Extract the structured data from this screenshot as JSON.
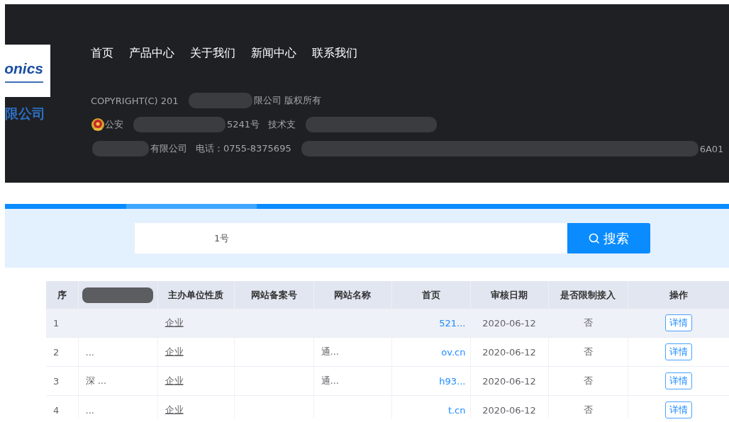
{
  "footer": {
    "logo": {
      "text": "onics",
      "subtitle": "限公司"
    },
    "nav": [
      {
        "label": "首页"
      },
      {
        "label": "产品中心"
      },
      {
        "label": "关于我们"
      },
      {
        "label": "新闻中心"
      },
      {
        "label": "联系我们"
      }
    ],
    "lines": [
      [
        {
          "kind": "text",
          "text": "COPYRIGHT(C) 201"
        },
        {
          "kind": "redacted"
        },
        {
          "kind": "text",
          "text": "限公司 版权所有"
        }
      ],
      [
        {
          "kind": "emblem"
        },
        {
          "kind": "text",
          "text": "公安"
        },
        {
          "kind": "redacted"
        },
        {
          "kind": "text",
          "text": "5241号"
        },
        {
          "kind": "text",
          "text": "技术支"
        },
        {
          "kind": "redacted"
        }
      ],
      [
        {
          "kind": "redacted"
        },
        {
          "kind": "text",
          "text": "有限公司"
        },
        {
          "kind": "text",
          "text": "电话：0755-8375695"
        },
        {
          "kind": "redacted"
        },
        {
          "kind": "text",
          "text": "6A01"
        }
      ]
    ]
  },
  "search": {
    "value": "1号",
    "button": "搜索"
  },
  "table": {
    "columns": [
      "序",
      "",
      "主办单位性质",
      "网站备案号",
      "网站名称",
      "首页",
      "审核日期",
      "是否限制接入",
      "操作"
    ],
    "rows": [
      {
        "highlighted": true,
        "index": "1",
        "unit": "",
        "nature": "企业",
        "record": "",
        "name": "",
        "homepage": "521...",
        "date": "2020-06-12",
        "restricted": "否",
        "action": "详情"
      },
      {
        "highlighted": false,
        "index": "2",
        "unit": "...",
        "nature": "企业",
        "record": "",
        "name": "通...",
        "homepage": "ov.cn",
        "date": "2020-06-12",
        "restricted": "否",
        "action": "详情"
      },
      {
        "highlighted": false,
        "index": "3",
        "unit": "深 ...",
        "nature": "企业",
        "record": "",
        "name": "通...",
        "homepage": "h93...",
        "date": "2020-06-12",
        "restricted": "否",
        "action": "详情"
      },
      {
        "highlighted": false,
        "index": "4",
        "unit": "...",
        "nature": "企业",
        "record": "",
        "name": "",
        "homepage": "t.cn",
        "date": "2020-06-12",
        "restricted": "否",
        "action": "详情"
      }
    ]
  }
}
